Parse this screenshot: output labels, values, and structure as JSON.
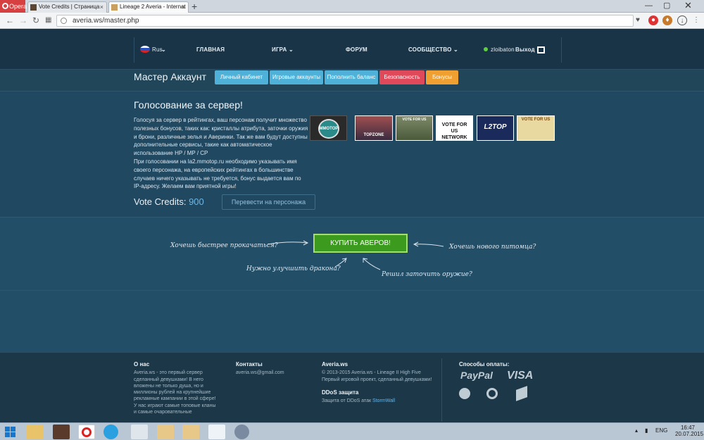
{
  "browser": {
    "opera_label": "Opera",
    "tabs": [
      {
        "label": "Vote Credits | Страница"
      },
      {
        "label": "Lineage 2 Averia - Internat"
      }
    ],
    "new_tab": "+",
    "url": "averia.ws/master.php"
  },
  "nav": {
    "lang": "Rus",
    "items": [
      "ГЛАВНАЯ",
      "ИГРА",
      "ФОРУМ",
      "СООБЩЕСТВО"
    ],
    "username": "zloibaton",
    "logout": "Выход"
  },
  "account": {
    "title": "Мастер Аккаунт",
    "buttons": [
      {
        "label": "Личный кабинет",
        "color": "#4fb0d8"
      },
      {
        "label": "Игровые аккаунты",
        "color": "#4fb0d8"
      },
      {
        "label": "Пополнить баланс",
        "color": "#4fb0d8"
      },
      {
        "label": "Безопасность",
        "color": "#e0495a"
      },
      {
        "label": "Бонусы",
        "color": "#f0a030"
      }
    ]
  },
  "vote": {
    "title": "Голосование за сервер!",
    "text": "Голосуя за сервер в рейтингах, ваш персонаж получит множество полезных бонусов, таких как: кристаллы атрибута, заточки оружия и брони, различные зелья и Аверинки. Так же вам будут доступны дополнительные сервисы, такие как автоматическое использование HP / MP / CP\nПри голосовании на la2.mmotop.ru необходимо указывать имя своего персонажа, на европейских рейтингах в большинстве случаев ничего указывать не требуется, бонус выдается вам по IP-адресу. Желаем вам приятной игры!",
    "credits_label": "Vote Credits:",
    "credits_value": "900",
    "transfer_button": "Перевести на персонажа",
    "banners": [
      {
        "name": "mmotop",
        "text": "MMOTOP"
      },
      {
        "name": "topzone",
        "text": "TOPZONE"
      },
      {
        "name": "hopzone",
        "text": "VOTE FOR US"
      },
      {
        "name": "network",
        "text": "VOTE FOR US NETWORK"
      },
      {
        "name": "l2top",
        "text": "L2TOP"
      },
      {
        "name": "l2topzone",
        "text": "VOTE FOR US"
      }
    ]
  },
  "buy": {
    "button": "КУПИТЬ АВЕРОВ!",
    "hints": [
      "Хочешь быстрее прокачаться?",
      "Хочешь нового питомца?",
      "Нужно улучшить дракона?",
      "Решил заточить оружие?"
    ]
  },
  "footer": {
    "about_title": "О нас",
    "about_text": "Averia.ws - это первый сервер сделанный девушками! В него вложены не только душа, но и миллионы рублей на крупнейшие рекламные кампании в этой сфере!\nУ нас играют самые топовые кланы и самые очаровательные",
    "contacts_title": "Контакты",
    "contacts_email": "averia.ws@gmail.com",
    "site_title": "Averia.ws",
    "site_copy": "© 2013-2015 Averia.ws - Lineage II High Five",
    "site_desc": "Первый игровой проект, сделанный девушками!",
    "ddos_title": "DDoS защита",
    "ddos_text": "Защита от DDoS атак",
    "ddos_link": "StormWall",
    "pay_title": "Способы оплаты:",
    "pay_paypal": "PayPal",
    "pay_visa": "VISA"
  },
  "taskbar": {
    "lang": "ENG",
    "time": "16:47",
    "date": "20.07.2015"
  }
}
